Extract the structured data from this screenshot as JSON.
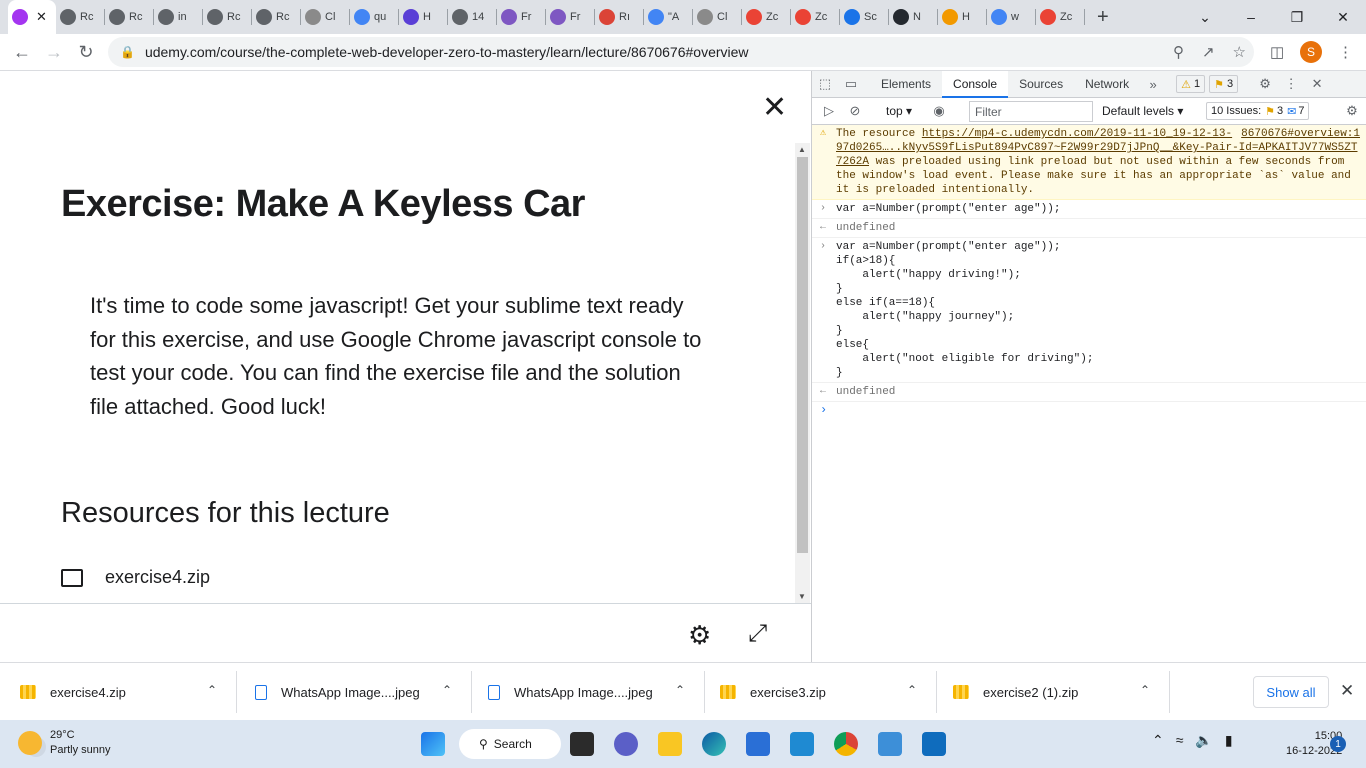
{
  "browser": {
    "tabs": [
      {
        "label": "",
        "icon": "udemy-icon",
        "color": "#a435f0",
        "active": true
      },
      {
        "label": "Rc",
        "icon": "globe-icon",
        "color": "#5f6368"
      },
      {
        "label": "Rc",
        "icon": "globe-icon",
        "color": "#5f6368"
      },
      {
        "label": "in",
        "icon": "globe-icon",
        "color": "#5f6368"
      },
      {
        "label": "Rc",
        "icon": "globe-icon",
        "color": "#5f6368"
      },
      {
        "label": "Rc",
        "icon": "globe-icon",
        "color": "#5f6368"
      },
      {
        "label": "Cl",
        "icon": "c-icon",
        "color": "#8a8a8a"
      },
      {
        "label": "qu",
        "icon": "google-icon",
        "color": "#4285f4"
      },
      {
        "label": "H",
        "icon": "u-icon",
        "color": "#5a3fd6"
      },
      {
        "label": "14",
        "icon": "globe-icon",
        "color": "#5f6368"
      },
      {
        "label": "Fr",
        "icon": "profile-icon",
        "color": "#7e57c2"
      },
      {
        "label": "Fr",
        "icon": "profile-icon",
        "color": "#7e57c2"
      },
      {
        "label": "Rı",
        "icon": "chrome-icon",
        "color": "#db4437"
      },
      {
        "label": "\"A",
        "icon": "google-icon",
        "color": "#4285f4"
      },
      {
        "label": "Cl",
        "icon": "c-icon",
        "color": "#8a8a8a"
      },
      {
        "label": "Zc",
        "icon": "gmail-icon",
        "color": "#ea4335"
      },
      {
        "label": "Zc",
        "icon": "gmail-icon",
        "color": "#ea4335"
      },
      {
        "label": "Sc",
        "icon": "gear-icon",
        "color": "#1a73e8"
      },
      {
        "label": "N",
        "icon": "github-icon",
        "color": "#24292f"
      },
      {
        "label": "H",
        "icon": "w-icon",
        "color": "#f29900"
      },
      {
        "label": "w",
        "icon": "google-icon",
        "color": "#4285f4"
      },
      {
        "label": "Zc",
        "icon": "gmail-icon",
        "color": "#ea4335"
      }
    ],
    "url": "udemy.com/course/the-complete-web-developer-zero-to-mastery/learn/lecture/8670676#overview",
    "profile_initial": "S",
    "accent": "#1a73e8"
  },
  "lecture": {
    "title": "Exercise: Make A Keyless Car",
    "body": "It's time to code some javascript! Get your sublime text ready for this exercise, and use Google Chrome javascript console to test your code. You can find the exercise file and the solution file attached. Good luck!",
    "resources_heading": "Resources for this lecture",
    "resource_file": "exercise4.zip"
  },
  "devtools": {
    "tabs": [
      "Elements",
      "Console",
      "Sources",
      "Network"
    ],
    "active_tab": "Console",
    "warning_count": "1",
    "info_count": "3",
    "context": "top",
    "filter_placeholder": "Filter",
    "levels": "Default levels",
    "issues_label": "10 Issues:",
    "issues_warn": "3",
    "issues_info": "7",
    "warning": {
      "prefix": "The resource ",
      "link1": "https://mp4-c.udemycdn.com/2019-11-10_19-12-13-97d0265…..kNyv5S9fLisPut894PvC897~F2W99r29D7jJPnQ__&Key-Pair-Id=APKAITJV77WS5ZT7262A",
      "link2": "8670676#overview:1",
      "suffix": " was preloaded using link preload but not used within a few seconds from the window's load event. Please make sure it has an appropriate `as` value and it is preloaded intentionally."
    },
    "log": [
      {
        "kind": "input",
        "text": "var a=Number(prompt(\"enter age\"));"
      },
      {
        "kind": "result",
        "text": "undefined"
      },
      {
        "kind": "input",
        "text": "var a=Number(prompt(\"enter age\"));\nif(a>18){\n    alert(\"happy driving!\");\n}\nelse if(a==18){\n    alert(\"happy journey\");\n}\nelse{\n    alert(\"noot eligible for driving\");\n}"
      },
      {
        "kind": "result",
        "text": "undefined"
      }
    ]
  },
  "downloads": {
    "items": [
      {
        "name": "exercise4.zip",
        "type": "zip"
      },
      {
        "name": "WhatsApp Image....jpeg",
        "type": "jpg"
      },
      {
        "name": "WhatsApp Image....jpeg",
        "type": "jpg"
      },
      {
        "name": "exercise3.zip",
        "type": "zip"
      },
      {
        "name": "exercise2 (1).zip",
        "type": "zip"
      }
    ],
    "show_all": "Show all"
  },
  "taskbar": {
    "temperature": "29°C",
    "weather": "Partly sunny",
    "search": "Search",
    "time": "15:00",
    "date": "16-12-2022",
    "notifications": "1"
  }
}
